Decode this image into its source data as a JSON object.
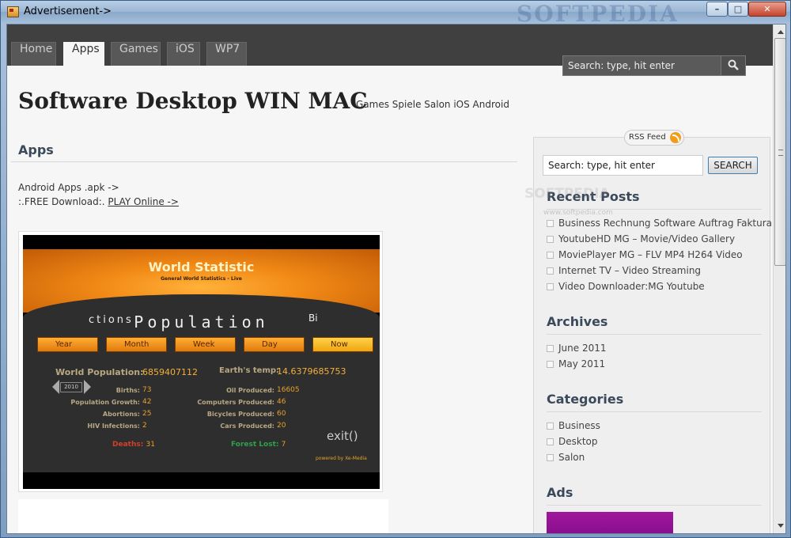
{
  "window": {
    "title": "Advertisement->",
    "brand_watermark": "SOFTPEDIA",
    "controls": {
      "minimize": "–",
      "maximize": "□",
      "close": "✕"
    }
  },
  "nav": {
    "tabs": [
      {
        "label": "Home"
      },
      {
        "label": "Apps",
        "active": true
      },
      {
        "label": "Games"
      },
      {
        "label": "iOS"
      },
      {
        "label": "WP7"
      }
    ],
    "search_placeholder": "Search: type, hit enter",
    "search_icon": "search-icon"
  },
  "header": {
    "site_title": "Software Desktop WIN MAC",
    "tagline": "Games Spiele Salon iOS Android"
  },
  "main": {
    "heading": "Apps",
    "line1": "Android Apps .apk ->",
    "line2_prefix": ":.FREE Download:. ",
    "play_link": "PLAY Online ->"
  },
  "game": {
    "title": "World Statistic",
    "subtitle": "General World Statistics - Live",
    "scroll_left": "ctions",
    "scroll_main": "Population",
    "scroll_right": "Bi",
    "buttons": [
      "Year",
      "Month",
      "Week",
      "Day",
      "Now"
    ],
    "world_population_label": "World Population:",
    "world_population_value": "6859407112",
    "earth_temp_label": "Earth's temp:",
    "earth_temp_value": "14.6379685753",
    "year": "2010",
    "stats_left": [
      {
        "label": "Births:",
        "value": "73"
      },
      {
        "label": "Population Growth:",
        "value": "42"
      },
      {
        "label": "Abortions:",
        "value": "25"
      },
      {
        "label": "HIV Infections:",
        "value": "2"
      }
    ],
    "stats_right": [
      {
        "label": "Oil Produced:",
        "value": "16605"
      },
      {
        "label": "Computers Produced:",
        "value": "46"
      },
      {
        "label": "Bicycles Produced:",
        "value": "60"
      },
      {
        "label": "Cars Produced:",
        "value": "20"
      }
    ],
    "deaths_label": "Deaths:",
    "deaths_value": "31",
    "forest_label": "Forest Lost:",
    "forest_value": "7",
    "exit": "exit()",
    "powered": "powered by Xe-Media"
  },
  "sidebar": {
    "rss": "RSS Feed",
    "search_placeholder": "Search: type, hit enter",
    "search_button": "SEARCH",
    "recent_heading": "Recent Posts",
    "recent": [
      "Business Rechnung Software Auftrag Faktura",
      "YoutubeHD MG – Movie/Video Gallery",
      "MoviePlayer MG – FLV MP4 H264 Video",
      "Internet TV – Video Streaming",
      "Video Downloader:MG Youtube"
    ],
    "archives_heading": "Archives",
    "archives": [
      "June 2011",
      "May 2011"
    ],
    "categories_heading": "Categories",
    "categories": [
      "Business",
      "Desktop",
      "Salon"
    ],
    "ads_heading": "Ads"
  },
  "watermark": {
    "text": "SOFTPEDIA",
    "url": "www.softpedia.com"
  }
}
